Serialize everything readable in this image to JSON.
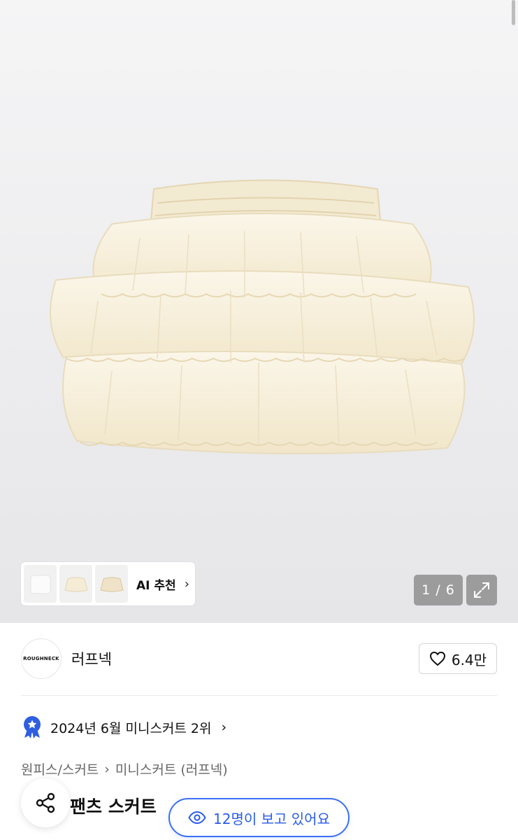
{
  "gallery": {
    "ai_recommend_label": "AI 추천",
    "counter": "1 / 6"
  },
  "brand": {
    "logo_text": "ROUGHNECK",
    "name": "러프넥",
    "like_count": "6.4만"
  },
  "ranking": {
    "text": "2024년 6월 미니스커트 2위"
  },
  "breadcrumb": {
    "items": [
      "원피스/스커트",
      "미니스커트 (러프넥)"
    ]
  },
  "product": {
    "title_visible": "팬츠 스커트"
  },
  "viewers": {
    "text": "12명이 보고 있어요"
  },
  "colors": {
    "accent": "#3b6ff5",
    "badge": "#2f5fe0",
    "skirt": "#f7f0dc"
  }
}
